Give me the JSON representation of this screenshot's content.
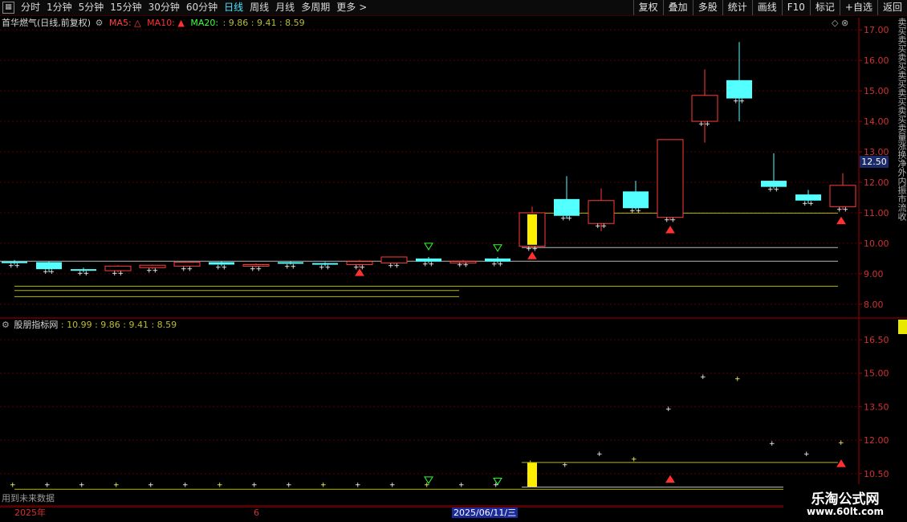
{
  "toolbar": {
    "left": [
      "分时",
      "1分钟",
      "5分钟",
      "15分钟",
      "30分钟",
      "60分钟",
      "日线",
      "周线",
      "月线",
      "多周期",
      "更多"
    ],
    "active": "日线",
    "more_arrow": ">",
    "right": [
      "复权",
      "叠加",
      "多股",
      "统计",
      "画线",
      "F10",
      "标记",
      "+自选",
      "返回"
    ]
  },
  "main_legend": {
    "stock": "首华燃气(日线,前复权)",
    "ma5": "MA5: △",
    "ma10": "MA10: ▲",
    "ma20": "MA20:",
    "ma_values": ": 9.86 : 9.41 : 8.59"
  },
  "lower_legend": {
    "name": "股朋指标网",
    "values": ": 10.99 : 9.86 : 9.41 : 8.59"
  },
  "main_axis": [
    "17.00",
    "16.00",
    "15.00",
    "14.00",
    "13.00",
    "12.00",
    "11.00",
    "10.00",
    "9.00",
    "8.00"
  ],
  "lower_axis": [
    "16.50",
    "15.00",
    "13.50",
    "12.00",
    "10.50"
  ],
  "price_label": "12.50",
  "side_text": "卖买卖买卖买卖买卖买卖买卖量涨换净外内振市流收",
  "chart_data": {
    "type": "candlestick",
    "ohlc": [
      [
        9.4,
        9.45,
        9.3,
        9.35
      ],
      [
        9.38,
        9.4,
        9.05,
        9.15
      ],
      [
        9.15,
        9.2,
        9.05,
        9.1
      ],
      [
        9.1,
        9.28,
        9.05,
        9.25
      ],
      [
        9.2,
        9.3,
        9.15,
        9.28
      ],
      [
        9.25,
        9.42,
        9.22,
        9.38
      ],
      [
        9.38,
        9.4,
        9.25,
        9.3
      ],
      [
        9.25,
        9.34,
        9.2,
        9.3
      ],
      [
        9.38,
        9.4,
        9.3,
        9.33
      ],
      [
        9.35,
        9.38,
        9.25,
        9.3
      ],
      [
        9.3,
        9.45,
        9.2,
        9.4
      ],
      [
        9.35,
        9.55,
        9.3,
        9.55
      ],
      [
        9.5,
        9.55,
        9.35,
        9.4
      ],
      [
        9.38,
        9.45,
        9.33,
        9.4
      ],
      [
        9.5,
        9.55,
        9.35,
        9.4
      ],
      [
        9.9,
        11.2,
        9.85,
        11.0
      ],
      [
        11.45,
        12.2,
        10.8,
        10.9
      ],
      [
        10.65,
        11.8,
        10.4,
        11.4
      ],
      [
        11.7,
        12.05,
        11.1,
        11.15
      ],
      [
        10.85,
        13.4,
        10.75,
        13.4
      ],
      [
        14.0,
        15.7,
        13.3,
        14.85
      ],
      [
        15.35,
        16.6,
        14.0,
        14.75
      ],
      [
        12.05,
        12.95,
        11.8,
        11.85
      ],
      [
        11.6,
        11.75,
        11.3,
        11.4
      ],
      [
        11.2,
        12.3,
        11.1,
        11.9
      ]
    ],
    "ma_lines": [
      10.99,
      9.86,
      9.41,
      8.59
    ],
    "ylim": [
      7.6,
      17.4
    ],
    "lower_ylim": [
      9.7,
      17.4
    ]
  },
  "misc": {
    "future_note": "用到未来数据",
    "date_year": "2025年",
    "date_month": "6",
    "date_cursor": "2025/06/11/三",
    "watermark_title": "乐淘公式网",
    "watermark_url": "www.60lt.com"
  }
}
